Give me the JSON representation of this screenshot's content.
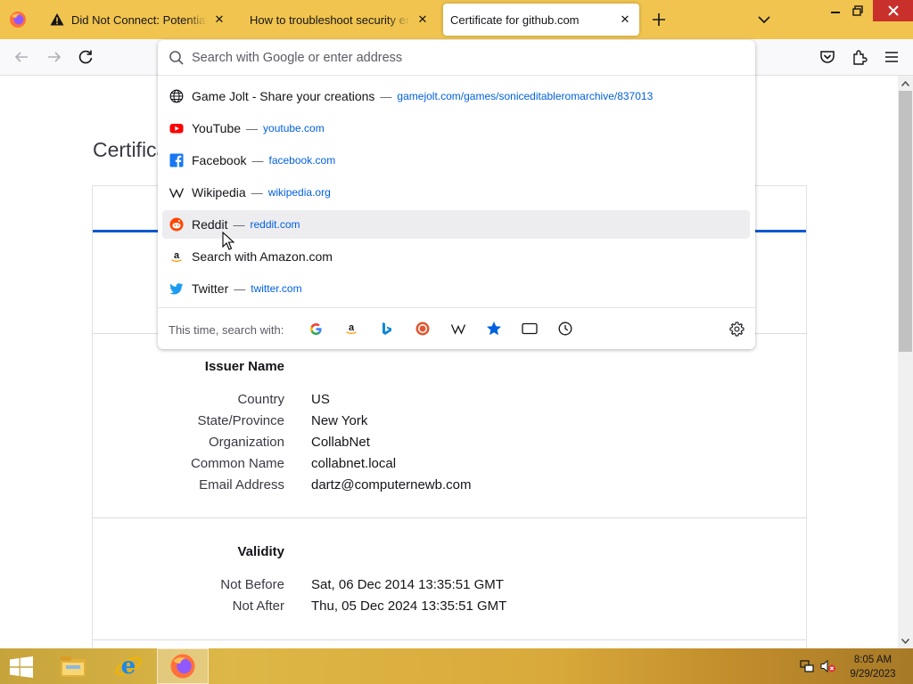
{
  "browser": {
    "tabs": [
      {
        "title": "Did Not Connect: Potential Security Issue",
        "icon": "warning-icon",
        "selected": false
      },
      {
        "title": "How to troubleshoot security error codes on secure websites",
        "icon": "none",
        "selected": false
      },
      {
        "title": "Certificate for github.com",
        "icon": "none",
        "selected": true
      }
    ],
    "accent_color": "#f0c44e"
  },
  "urlbar": {
    "placeholder": "Search with Google or enter address",
    "value": "",
    "results": [
      {
        "title": "Game Jolt - Share your creations",
        "url": "gamejolt.com/games/soniceditableromarchive/837013",
        "icon": "globe-icon"
      },
      {
        "title": "YouTube",
        "url": "youtube.com",
        "icon": "youtube-icon"
      },
      {
        "title": "Facebook",
        "url": "facebook.com",
        "icon": "facebook-icon"
      },
      {
        "title": "Wikipedia",
        "url": "wikipedia.org",
        "icon": "wikipedia-icon"
      },
      {
        "title": "Reddit",
        "url": "reddit.com",
        "icon": "reddit-icon",
        "hovered": true
      },
      {
        "title": "Search with Amazon.com",
        "url": "",
        "icon": "amazon-icon"
      },
      {
        "title": "Twitter",
        "url": "twitter.com",
        "icon": "twitter-icon"
      }
    ],
    "separator": "—",
    "one_off_label": "This time, search with:",
    "one_off_engines": [
      "google-icon",
      "amazon-icon",
      "bing-icon",
      "duckduckgo-icon",
      "wikipedia-icon",
      "bookmarks-icon",
      "tabs-icon",
      "history-icon"
    ]
  },
  "page": {
    "title": "Certificate for github.com",
    "issuer": {
      "heading": "Issuer Name",
      "rows": [
        {
          "label": "Country",
          "value": "US"
        },
        {
          "label": "State/Province",
          "value": "New York"
        },
        {
          "label": "Organization",
          "value": "CollabNet"
        },
        {
          "label": "Common Name",
          "value": "collabnet.local"
        },
        {
          "label": "Email Address",
          "value": "dartz@computernewb.com"
        }
      ]
    },
    "validity": {
      "heading": "Validity",
      "rows": [
        {
          "label": "Not Before",
          "value": "Sat, 06 Dec 2014 13:35:51 GMT"
        },
        {
          "label": "Not After",
          "value": "Thu, 05 Dec 2024 13:35:51 GMT"
        }
      ]
    }
  },
  "taskbar": {
    "apps": [
      "file-explorer-icon",
      "internet-explorer-icon",
      "firefox-icon"
    ],
    "clock_time": "8:05 AM",
    "clock_date": "9/29/2023"
  }
}
